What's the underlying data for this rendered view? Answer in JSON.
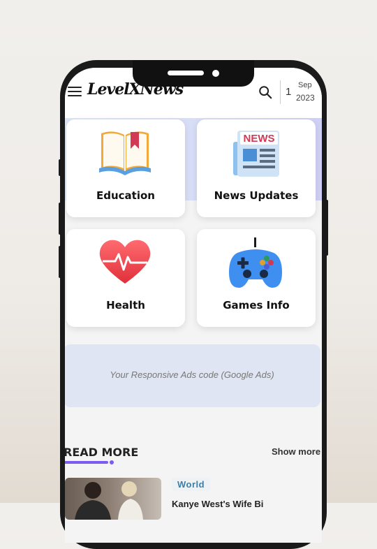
{
  "header": {
    "logo_text": "LevelXNews",
    "date": {
      "day": "1",
      "month": "Sep",
      "year": "2023"
    }
  },
  "categories": [
    {
      "label": "Education",
      "icon": "open-book-icon"
    },
    {
      "label": "News Updates",
      "icon": "newspaper-icon"
    },
    {
      "label": "Health",
      "icon": "heart-pulse-icon"
    },
    {
      "label": "Games Info",
      "icon": "gamepad-icon"
    }
  ],
  "ads": {
    "text": "Your Responsive Ads code (Google Ads)"
  },
  "read_more": {
    "title": "READ MORE",
    "show_more": "Show more",
    "article": {
      "tag": "World",
      "title": "Kanye West's Wife Bi"
    }
  },
  "icons": {
    "newspaper_badge": "NEWS"
  },
  "colors": {
    "accent": "#7c5cf0",
    "tag_text": "#3b7fa8"
  }
}
